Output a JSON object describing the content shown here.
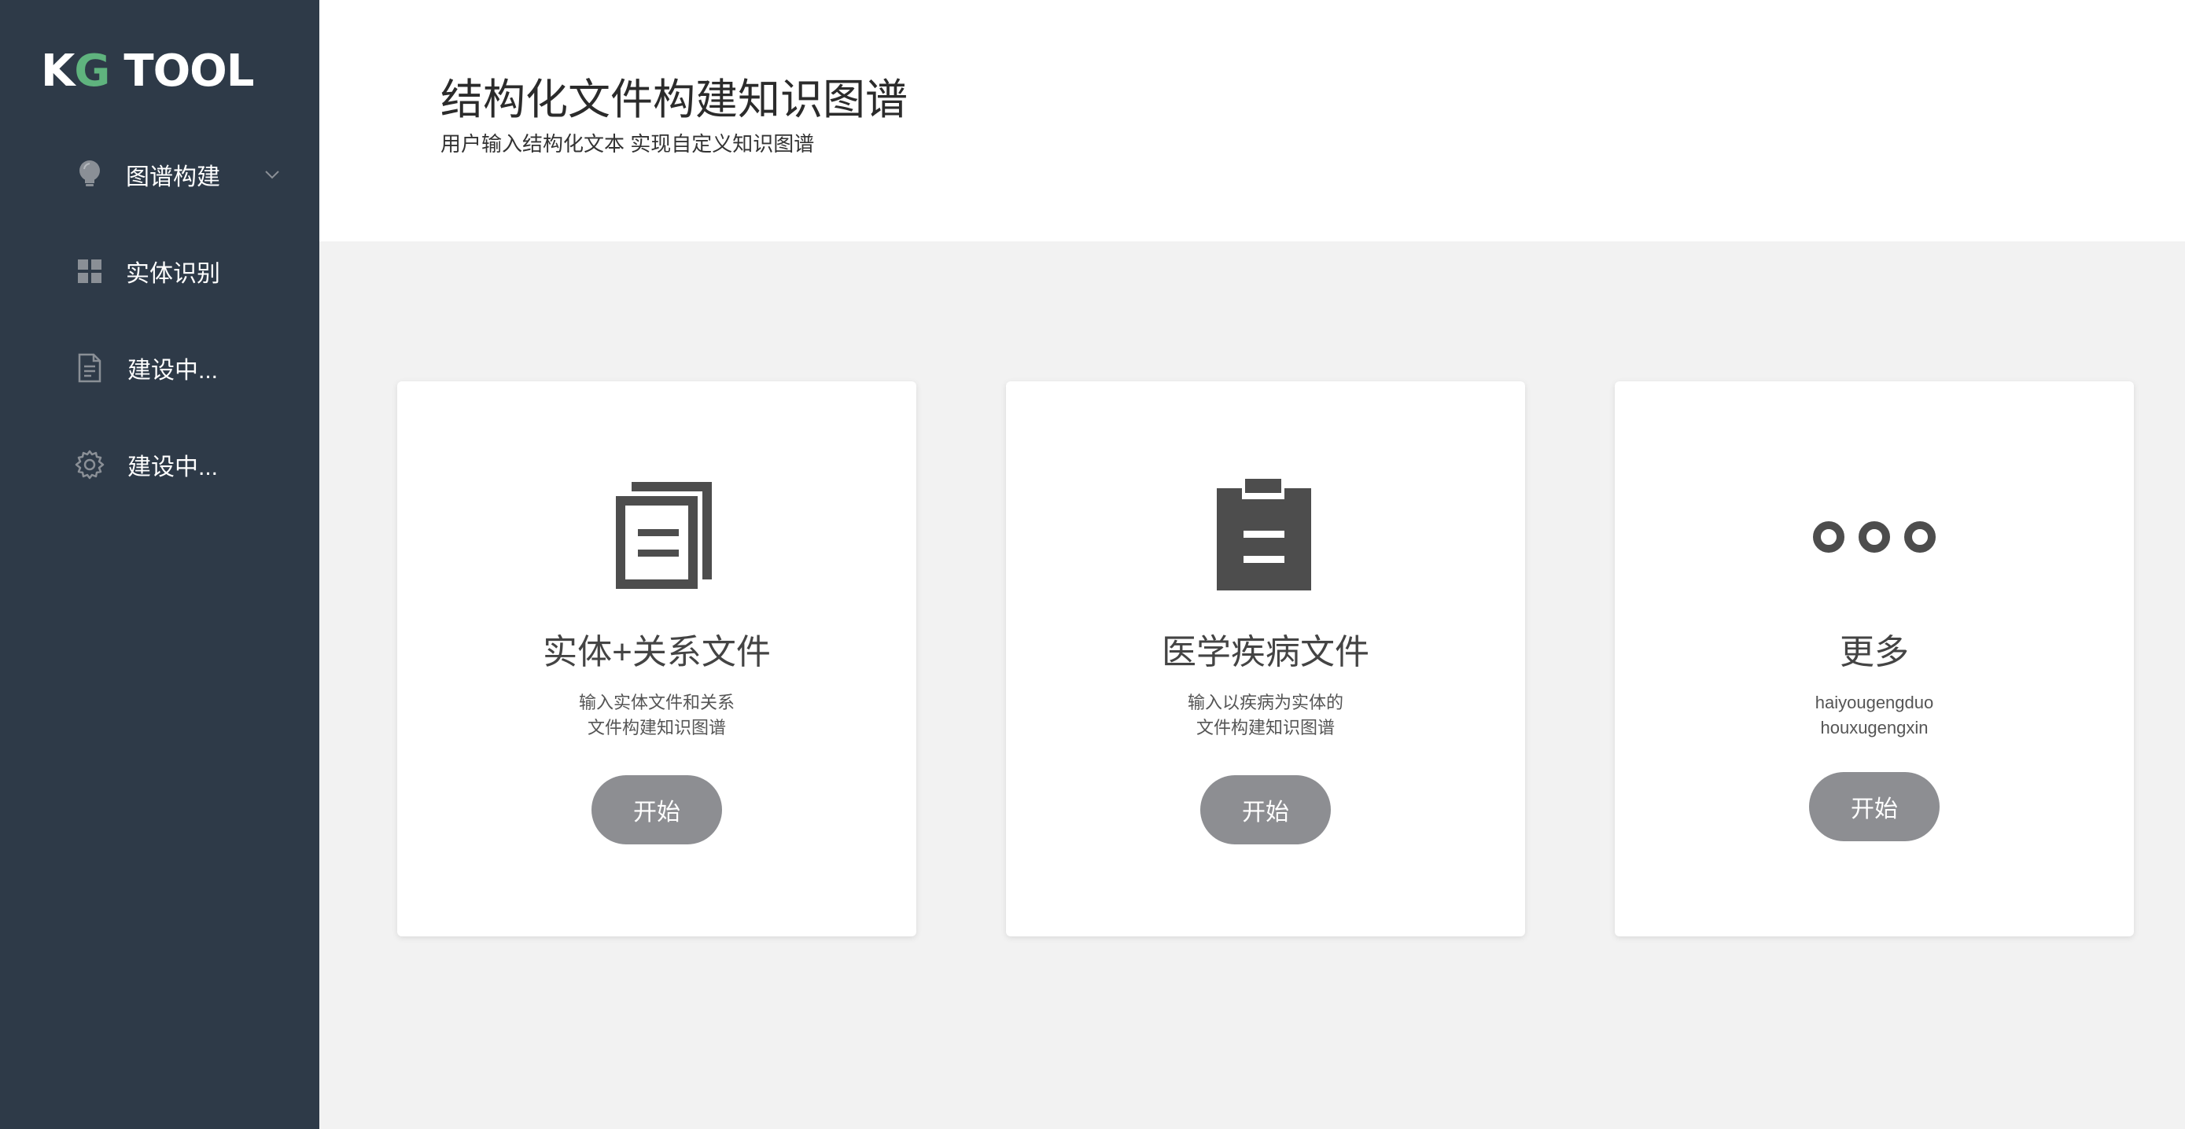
{
  "app": {
    "logo_prefix": "K",
    "logo_g": "G",
    "logo_suffix": "TOOL"
  },
  "sidebar": {
    "items": [
      {
        "label": "图谱构建",
        "icon": "bulb-icon",
        "has_chevron": true
      },
      {
        "label": "实体识别",
        "icon": "grid-icon"
      },
      {
        "label": "建设中...",
        "icon": "document-icon"
      },
      {
        "label": "建设中...",
        "icon": "gear-icon"
      }
    ]
  },
  "header": {
    "title": "结构化文件构建知识图谱",
    "subtitle": "用户输入结构化文本 实现自定义知识图谱"
  },
  "cards": [
    {
      "icon": "copy-files-icon",
      "title": "实体+关系文件",
      "desc_line1": "输入实体文件和关系",
      "desc_line2": "文件构建知识图谱",
      "button": "开始"
    },
    {
      "icon": "clipboard-icon",
      "title": "医学疾病文件",
      "desc_line1": "输入以疾病为实体的",
      "desc_line2": "文件构建知识图谱",
      "button": "开始"
    },
    {
      "icon": "more-dots-icon",
      "title": "更多",
      "desc_line1": "haiyougengduo",
      "desc_line2": "houxugengxin",
      "button": "开始"
    }
  ],
  "colors": {
    "sidebar_bg": "#2e3a48",
    "page_bg": "#f2f2f2",
    "card_bg": "#ffffff",
    "icon_gray": "#4d4d4d",
    "button_gray": "#8d8e92",
    "logo_accent": "#5fb37e"
  }
}
